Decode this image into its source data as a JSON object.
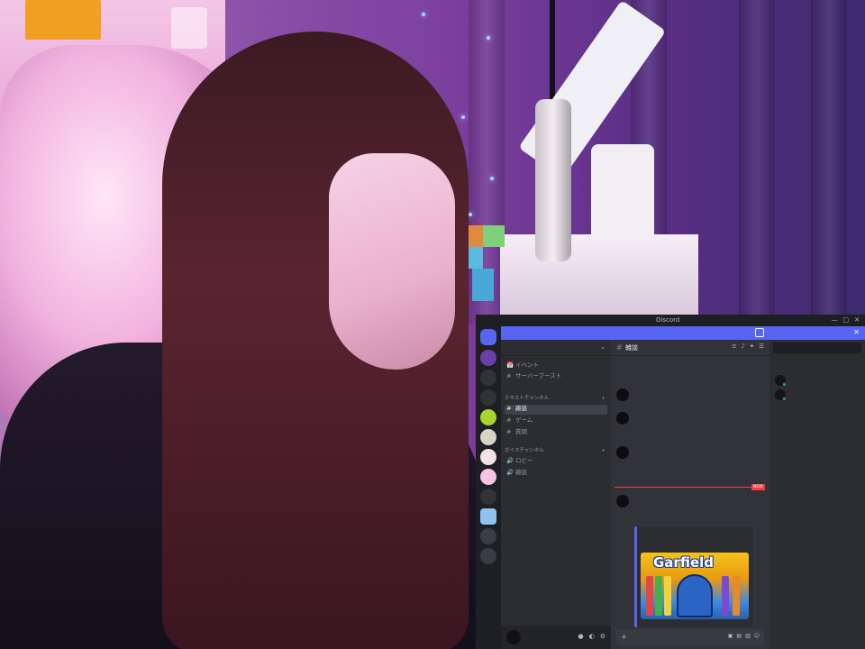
{
  "window": {
    "title": "Discord",
    "controls": [
      "—",
      "□",
      "✕"
    ]
  },
  "banner": {
    "text": "",
    "button": "",
    "close": "✕"
  },
  "server": {
    "name": "",
    "menu_icon": "chevron-down-icon"
  },
  "channels": {
    "items": [
      {
        "symbol": "📅",
        "label": "イベント"
      },
      {
        "symbol": "#",
        "label": "サーバーブースト"
      }
    ],
    "categories": [
      {
        "label": "テキストチャンネル",
        "items": [
          {
            "symbol": "#",
            "label": "雑談",
            "active": true
          },
          {
            "symbol": "#",
            "label": "ゲーム"
          },
          {
            "symbol": "#",
            "label": "質問"
          }
        ]
      },
      {
        "label": "ボイスチャンネル",
        "items": [
          {
            "symbol": "🔊",
            "label": "ロビー"
          },
          {
            "symbol": "🔊",
            "label": "雑談"
          }
        ]
      }
    ]
  },
  "user_panel": {
    "name": "",
    "status": "",
    "controls": [
      "mic-icon",
      "headphones-icon",
      "settings-icon"
    ]
  },
  "chat": {
    "channel_name": "雑談",
    "header_icons": [
      "threads-icon",
      "bell-icon",
      "pin-icon",
      "members-icon"
    ],
    "messages": [
      {
        "author": "",
        "time": "",
        "text": "",
        "text2": ""
      },
      {
        "author": "",
        "time": "",
        "text": "",
        "text2": ""
      },
      {
        "author": "",
        "time": "",
        "text": "",
        "text2": ""
      },
      {
        "author": "",
        "time": "",
        "text": "",
        "text2": ""
      },
      {
        "author": "",
        "time": "",
        "text": "",
        "text2": ""
      }
    ],
    "new_tag": "NEW",
    "link": "",
    "embed": {
      "title": "",
      "description": "",
      "image_logo": "Garfield"
    },
    "last_message": "",
    "composer_placeholder": "",
    "composer_plus": "+"
  },
  "members": {
    "search_placeholder": "",
    "heading": "",
    "list": [
      {
        "name": ""
      },
      {
        "name": ""
      }
    ]
  },
  "colors": {
    "blurple": "#5865f2",
    "online": "#23a55a",
    "new_marker": "#f23f43",
    "link": "#00a8fc"
  }
}
